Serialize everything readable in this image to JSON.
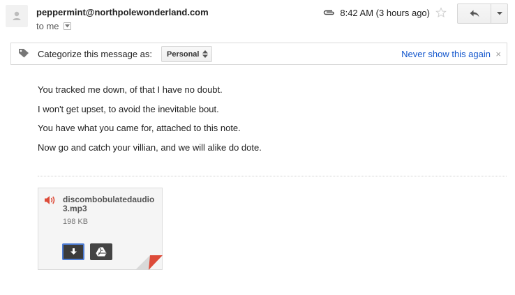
{
  "header": {
    "sender": "peppermint@northpolewonderland.com",
    "to_label": "to me",
    "timestamp": "8:42 AM (3 hours ago)"
  },
  "icons": {
    "avatar": "person-avatar-icon",
    "attachment": "paperclip-icon",
    "star": "star-outline-icon",
    "reply": "reply-arrow-icon",
    "more": "caret-down-icon",
    "tag": "tag-icon",
    "audio": "speaker-icon",
    "download": "download-arrow-icon",
    "drive": "drive-icon"
  },
  "category_bar": {
    "label": "Categorize this message as:",
    "selected": "Personal",
    "never_link": "Never show this again",
    "close": "×"
  },
  "message": {
    "lines": [
      "You tracked me down, of that I have no doubt.",
      "I won't get upset, to avoid the inevitable bout.",
      "You have what you came for, attached to this note.",
      "Now go and catch your villian, and we will alike do dote."
    ]
  },
  "attachment": {
    "filename": "discombobulatedaudio3.mp3",
    "size": "198 KB"
  },
  "colors": {
    "link": "#1155cc",
    "audio_red": "#dd4b39",
    "download_focus": "#4d7cd4",
    "corner_red": "#dd4b39"
  }
}
